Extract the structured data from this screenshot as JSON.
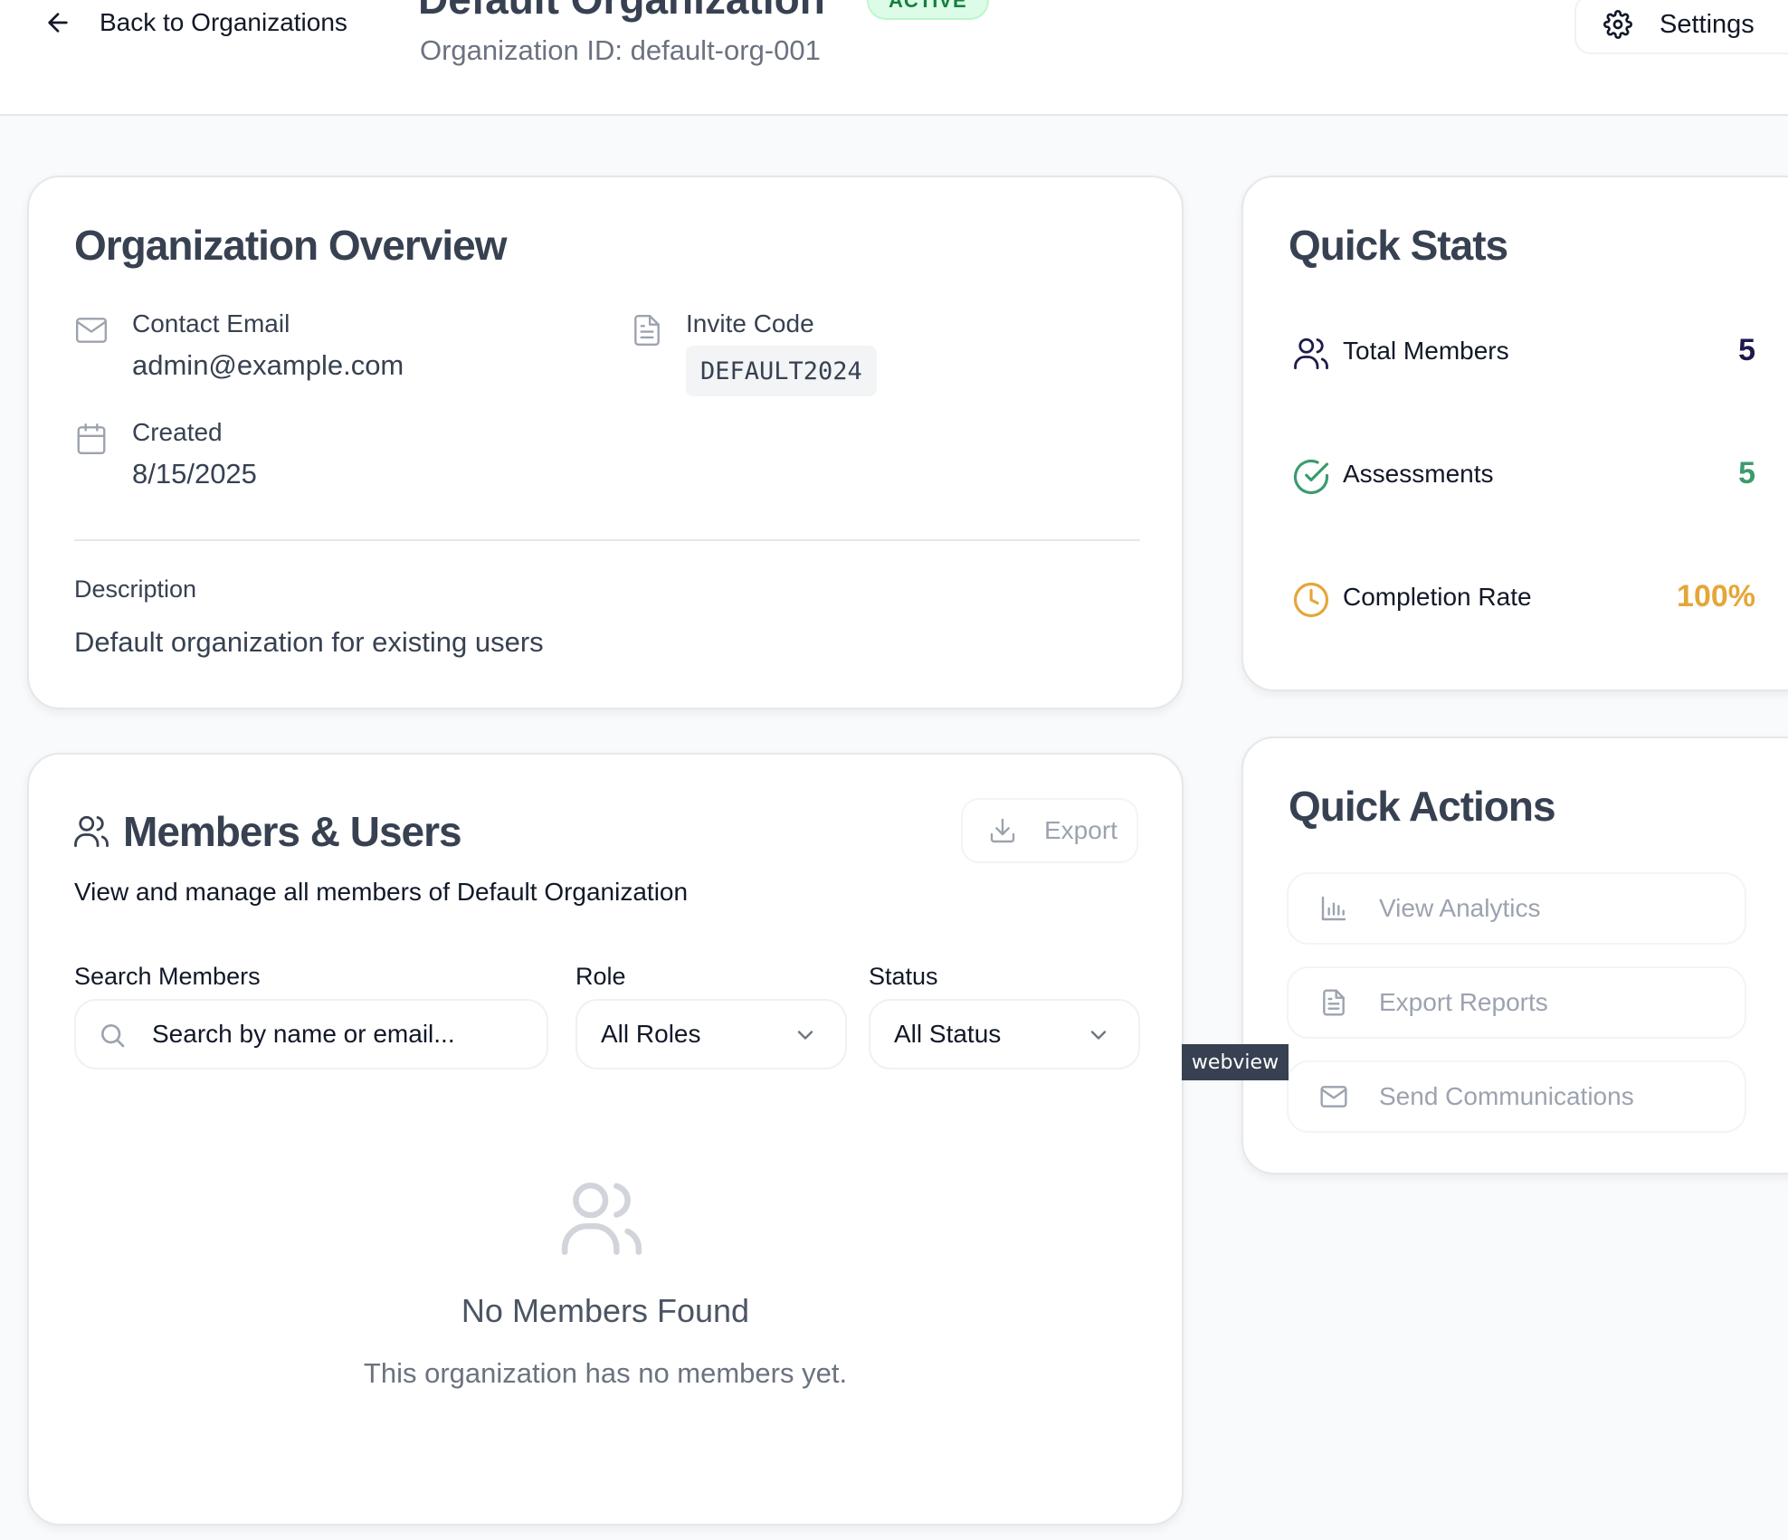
{
  "header": {
    "back_label": "Back to Organizations",
    "title": "Default Organization",
    "status": "ACTIVE",
    "org_id": "Organization ID: default-org-001",
    "settings_label": "Settings"
  },
  "overview": {
    "title": "Organization Overview",
    "contact_email_label": "Contact Email",
    "contact_email": "admin@example.com",
    "invite_code_label": "Invite Code",
    "invite_code": "DEFAULT2024",
    "created_label": "Created",
    "created": "8/15/2025",
    "description_label": "Description",
    "description": "Default organization for existing users"
  },
  "quick_stats": {
    "title": "Quick Stats",
    "items": [
      {
        "label": "Total Members",
        "value": "5",
        "color": "#1e1b4b",
        "icon": "users-icon"
      },
      {
        "label": "Assessments",
        "value": "5",
        "color": "#3c9b6e",
        "icon": "check-circle-icon"
      },
      {
        "label": "Completion Rate",
        "value": "100%",
        "color": "#e5a638",
        "icon": "clock-icon"
      }
    ]
  },
  "quick_actions": {
    "title": "Quick Actions",
    "items": [
      {
        "label": "View Analytics",
        "icon": "bar-chart-icon"
      },
      {
        "label": "Export Reports",
        "icon": "document-icon"
      },
      {
        "label": "Send Communications",
        "icon": "mail-icon"
      }
    ]
  },
  "members": {
    "title": "Members & Users",
    "subtitle": "View and manage all members of Default Organization",
    "export_label": "Export",
    "search_label": "Search Members",
    "search_placeholder": "Search by name or email...",
    "role_label": "Role",
    "role_value": "All Roles",
    "status_label": "Status",
    "status_value": "All Status",
    "empty_title": "No Members Found",
    "empty_text": "This organization has no members yet."
  },
  "tooltip": "webview"
}
